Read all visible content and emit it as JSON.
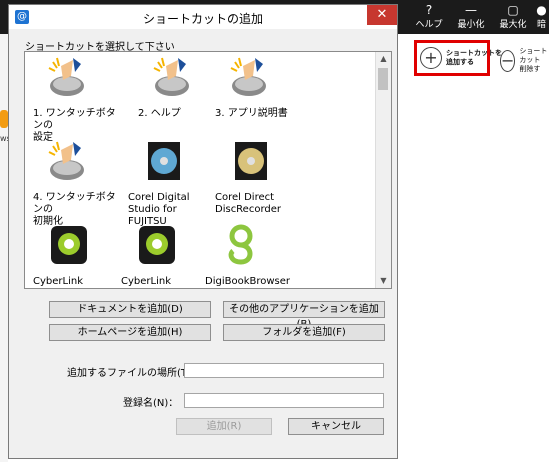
{
  "toolbar": {
    "help": "ヘルプ",
    "minimize": "最小化",
    "maximize": "最大化",
    "partial": "暗"
  },
  "right_pane": {
    "add_shortcut": "ショートカットを\n追加する",
    "remove_shortcut": "ショートカット\n削除す"
  },
  "left_edge_text": "ws",
  "dialog": {
    "title": "ショートカットの追加",
    "close": "✕",
    "select_label": "ショートカットを選択して下さい",
    "items": [
      {
        "label": "1. ワンタッチボタンの\n設定",
        "icon": "one-touch-button-icon"
      },
      {
        "label": "2. ヘルプ",
        "icon": "one-touch-button-icon"
      },
      {
        "label": "3. アプリ説明書",
        "icon": "one-touch-button-icon"
      },
      {
        "label": "4. ワンタッチボタンの\n初期化",
        "icon": "one-touch-button-icon"
      },
      {
        "label": "Corel Digital\nStudio for\nFUJITSU",
        "icon": "disc-icon"
      },
      {
        "label": "Corel Direct\nDiscRecorder",
        "icon": "disc-recorder-icon"
      },
      {
        "label": "CyberLink\nYouCam",
        "icon": "webcam-icon"
      },
      {
        "label": "CyberLink\nYouCam ミラー",
        "icon": "webcam-icon"
      },
      {
        "label": "DigiBookBrowser",
        "icon": "digibook-icon"
      }
    ],
    "buttons": {
      "add_document": "ドキュメントを追加(D)",
      "add_other_app": "その他のアプリケーションを追加(B)",
      "add_homepage": "ホームページを追加(H)",
      "add_folder": "フォルダを追加(F)",
      "add": "追加(R)",
      "cancel": "キャンセル"
    },
    "file_location_label": "追加するファイルの場所(T)：",
    "file_location_value": "",
    "register_name_label": "登録名(N)：",
    "register_name_value": ""
  }
}
